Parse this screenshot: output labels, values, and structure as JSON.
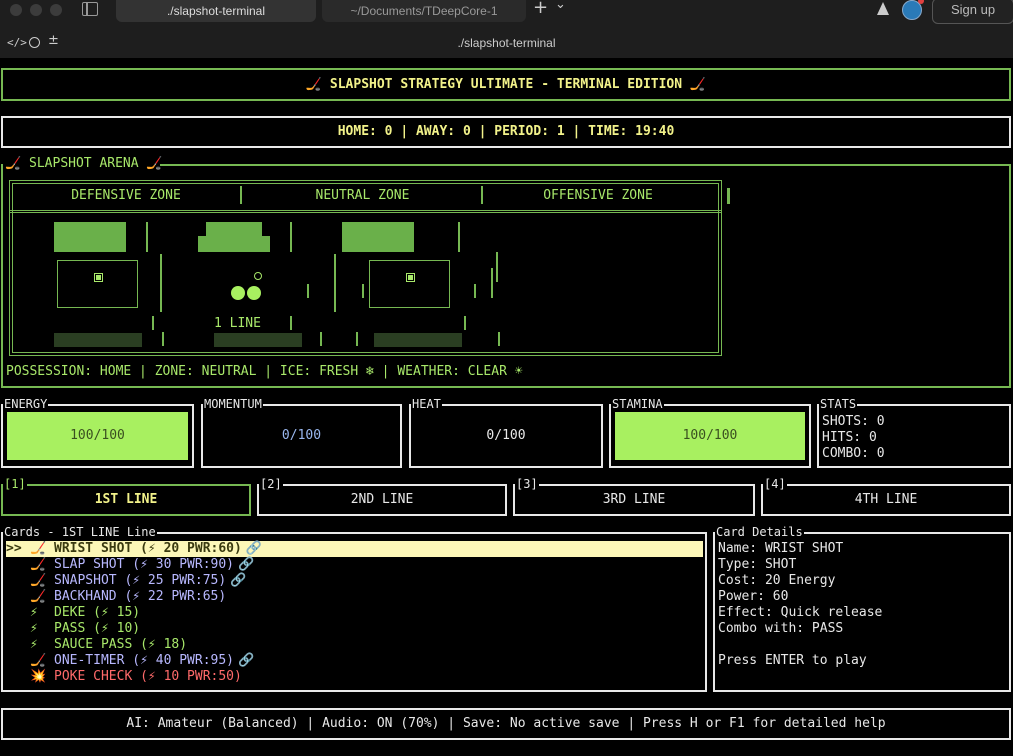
{
  "window": {
    "tabs": [
      {
        "label": "./slapshot-terminal",
        "active": true
      },
      {
        "label": "~/Documents/TDeepCore-1",
        "active": false
      }
    ],
    "title": "./slapshot-terminal",
    "signup_label": "Sign up",
    "new_tab_glyph": "+",
    "chevron_glyph": "⌄"
  },
  "header": {
    "title": "🏒 SLAPSHOT STRATEGY ULTIMATE - TERMINAL EDITION 🏒"
  },
  "score": {
    "line": "HOME: 0 | AWAY: 0 | PERIOD: 1 | TIME: 19:40"
  },
  "arena": {
    "label": "🏒 SLAPSHOT ARENA 🏒",
    "zones": [
      "DEFENSIVE ZONE",
      "NEUTRAL ZONE",
      "OFFENSIVE ZONE"
    ],
    "center_text": "1 LINE",
    "status": "POSSESSION: HOME | ZONE: NEUTRAL | ICE: FRESH ❄ | WEATHER: CLEAR ☀"
  },
  "meters": [
    {
      "label": "ENERGY",
      "text": "100/100",
      "value": 100,
      "max": 100,
      "fill": "#a8f060",
      "text_color": "#3a5020"
    },
    {
      "label": "MOMENTUM",
      "text": "0/100",
      "value": 0,
      "max": 100,
      "fill": "#000000",
      "text_color": "#9ab8f0"
    },
    {
      "label": "HEAT",
      "text": "0/100",
      "value": 0,
      "max": 100,
      "fill": "#000000",
      "text_color": "#e8e8e8"
    },
    {
      "label": "STAMINA",
      "text": "100/100",
      "value": 100,
      "max": 100,
      "fill": "#a8f060",
      "text_color": "#3a5020"
    }
  ],
  "stats": {
    "label": "STATS",
    "shots": "SHOTS: 0",
    "hits": "HITS: 0",
    "combo": "COMBO: 0"
  },
  "lines": [
    {
      "key": "[1]",
      "label": "1ST LINE",
      "active": true
    },
    {
      "key": "[2]",
      "label": "2ND LINE",
      "active": false
    },
    {
      "key": "[3]",
      "label": "3RD LINE",
      "active": false
    },
    {
      "key": "[4]",
      "label": "4TH LINE",
      "active": false
    }
  ],
  "cards": {
    "label": "Cards - 1ST LINE Line",
    "cursor": ">>",
    "items": [
      {
        "icon": "🏒",
        "text": "WRIST SHOT (⚡ 20 PWR:60)",
        "link": "🔗",
        "color": "#3a3a10",
        "selected": true
      },
      {
        "icon": "🏒",
        "text": "SLAP SHOT (⚡ 30 PWR:90)",
        "link": "🔗",
        "color": "#b8b8ff",
        "selected": false
      },
      {
        "icon": "🏒",
        "text": "SNAPSHOT (⚡ 25 PWR:75)",
        "link": "🔗",
        "color": "#b8b8ff",
        "selected": false
      },
      {
        "icon": "🏒",
        "text": "BACKHAND (⚡ 22 PWR:65)",
        "link": "",
        "color": "#b8b8ff",
        "selected": false
      },
      {
        "icon": "⚡",
        "text": "DEKE (⚡ 15)",
        "link": "",
        "color": "#a8e86a",
        "selected": false
      },
      {
        "icon": "⚡",
        "text": "PASS (⚡ 10)",
        "link": "",
        "color": "#a8e86a",
        "selected": false
      },
      {
        "icon": "⚡",
        "text": "SAUCE PASS (⚡ 18)",
        "link": "",
        "color": "#a8e86a",
        "selected": false
      },
      {
        "icon": "🏒",
        "text": "ONE-TIMER (⚡ 40 PWR:95)",
        "link": "🔗",
        "color": "#b8b8ff",
        "selected": false
      },
      {
        "icon": "💥",
        "text": "POKE CHECK (⚡ 10 PWR:50)",
        "link": "",
        "color": "#ff6a6a",
        "selected": false
      }
    ]
  },
  "details": {
    "label": "Card Details",
    "lines": [
      "Name: WRIST SHOT",
      "Type: SHOT",
      "Cost: 20 Energy",
      "Power: 60",
      "Effect: Quick release",
      "Combo with: PASS",
      "",
      "Press ENTER to play"
    ]
  },
  "footer": {
    "text": "AI: Amateur (Balanced) | Audio: ON (70%) | Save: No active save | Press H or F1 for detailed help"
  },
  "colors": {
    "green": "#76b852",
    "yellow": "#f2f28a",
    "bright_green": "#a8f060",
    "highlight": "#fcf7b8"
  }
}
